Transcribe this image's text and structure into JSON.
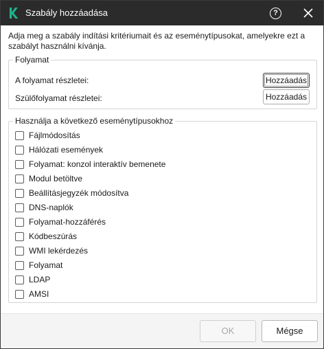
{
  "window": {
    "title": "Szabály hozzáadása",
    "help_glyph": "?",
    "icons": {
      "logo": "kaspersky-k-logo-icon",
      "help": "help-icon",
      "close": "close-icon"
    },
    "colors": {
      "titlebar": "#2b2b2b",
      "logo": "#1fb58f"
    }
  },
  "intro": "Adja meg a szabály indítási kritériumait és az eseménytípusokat, amelyekre ezt a szabályt használni kívánja.",
  "process_group": {
    "legend": "Folyamat",
    "rows": [
      {
        "label": "A folyamat részletei:",
        "button": "Hozzáadás"
      },
      {
        "label": "Szülőfolyamat részletei:",
        "button": "Hozzáadás"
      }
    ]
  },
  "event_group": {
    "legend": "Használja a következő eseménytípusokhoz",
    "items": [
      {
        "label": "Fájlmódosítás",
        "checked": false
      },
      {
        "label": "Hálózati események",
        "checked": false
      },
      {
        "label": "Folyamat: konzol interaktív bemenete",
        "checked": false
      },
      {
        "label": "Modul betöltve",
        "checked": false
      },
      {
        "label": "Beállításjegyzék módosítva",
        "checked": false
      },
      {
        "label": "DNS-naplók",
        "checked": false
      },
      {
        "label": "Folyamat-hozzáférés",
        "checked": false
      },
      {
        "label": "Kódbeszúrás",
        "checked": false
      },
      {
        "label": "WMI lekérdezés",
        "checked": false
      },
      {
        "label": "Folyamat",
        "checked": false
      },
      {
        "label": "LDAP",
        "checked": false
      },
      {
        "label": "AMSI",
        "checked": false
      }
    ]
  },
  "footer": {
    "ok_label": "OK",
    "ok_enabled": false,
    "cancel_label": "Mégse"
  }
}
